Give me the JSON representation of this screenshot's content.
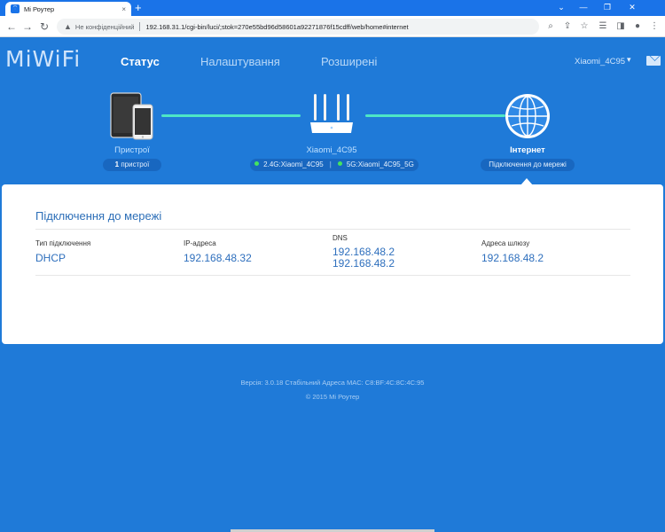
{
  "browser": {
    "tab_title": "Mi Роутер",
    "tab_close": "×",
    "new_tab": "+",
    "security_label": "Не конфіденційний",
    "url": "192.168.31.1/cgi-bin/luci/;stok=270e55bd96d58601a92271876f15cdff/web/home#internet",
    "controls": {
      "minimize": "—",
      "maximize": "❐",
      "close": "✕",
      "dropdown": "⌄"
    }
  },
  "header": {
    "logo": "MiWiFi",
    "nav": [
      "Статус",
      "Налаштування",
      "Розширені"
    ],
    "active_nav": 0,
    "router_name": "Xiaomi_4C95"
  },
  "topology": {
    "devices": {
      "label": "Пристрої",
      "count_bold": "1",
      "count_text": " пристрої"
    },
    "router": {
      "name": "Xiaomi_4C95",
      "wifi_24": "2.4G:Xiaomi_4C95",
      "wifi_5": "5G:Xiaomi_4C95_5G"
    },
    "internet": {
      "label": "Інтернет",
      "status": "Підключення до мережі"
    }
  },
  "connection": {
    "title": "Підключення до мережі",
    "columns": [
      {
        "label": "Тип підключення",
        "values": [
          "DHCP"
        ]
      },
      {
        "label": "IP-адреса",
        "values": [
          "192.168.48.32"
        ]
      },
      {
        "label": "DNS",
        "values": [
          "192.168.48.2",
          "192.168.48.2"
        ]
      },
      {
        "label": "Адреса шлюзу",
        "values": [
          "192.168.48.2"
        ]
      }
    ]
  },
  "footer": {
    "version_line": "Версія: 3.0.18 Стабільний  Адреса MAC: C8:BF:4C:8C:4C:95",
    "copyright": "© 2015 Mi Роутер"
  },
  "colors": {
    "brand_blue": "#1f7ad8",
    "link_line": "#4ee6c5",
    "status_dot": "#45e35f",
    "value_text": "#2e6fbd"
  }
}
